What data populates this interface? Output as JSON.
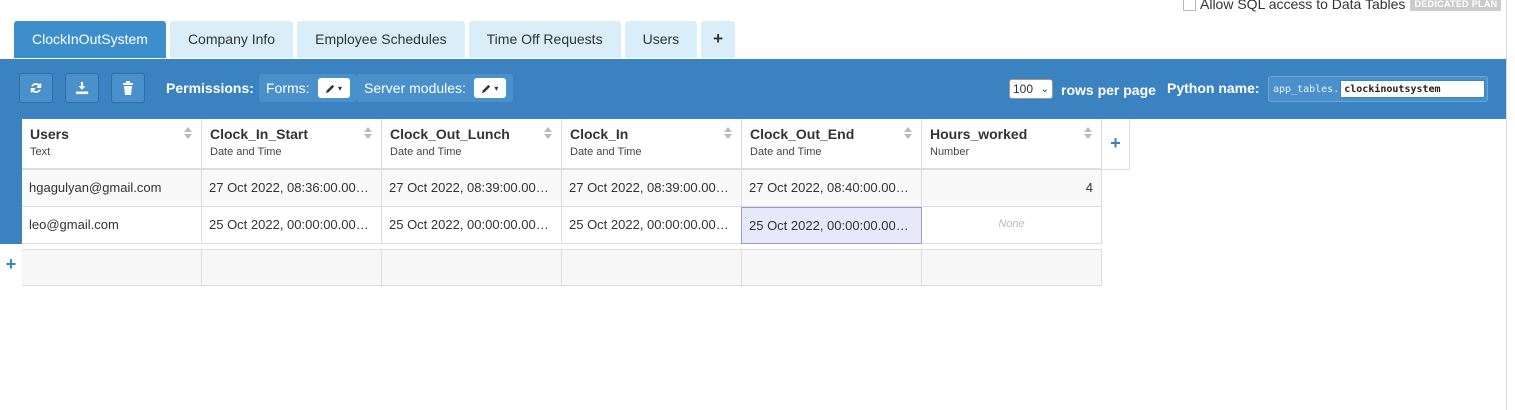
{
  "sql_option": {
    "label": "Allow SQL access to Data Tables",
    "badge": "DEDICATED PLAN"
  },
  "tabs": [
    {
      "label": "ClockInOutSystem",
      "active": true
    },
    {
      "label": "Company Info"
    },
    {
      "label": "Employee Schedules"
    },
    {
      "label": "Time Off Requests"
    },
    {
      "label": "Users"
    }
  ],
  "add_tab_label": "+",
  "toolbar": {
    "permissions_label": "Permissions:",
    "forms_label": "Forms:",
    "server_modules_label": "Server modules:",
    "rows_per_page_value": "100",
    "rows_per_page_label": "rows per page",
    "python_name_label": "Python name:",
    "python_prefix": "app_tables.",
    "python_name_value": "clockinoutsystem"
  },
  "columns": [
    {
      "name": "Users",
      "type": "Text"
    },
    {
      "name": "Clock_In_Start",
      "type": "Date and Time"
    },
    {
      "name": "Clock_Out_Lunch",
      "type": "Date and Time"
    },
    {
      "name": "Clock_In",
      "type": "Date and Time"
    },
    {
      "name": "Clock_Out_End",
      "type": "Date and Time"
    },
    {
      "name": "Hours_worked",
      "type": "Number"
    }
  ],
  "rows": [
    [
      "hgagulyan@gmail.com",
      "27 Oct 2022, 08:36:00.000…",
      "27 Oct 2022, 08:39:00.000…",
      "27 Oct 2022, 08:39:00.000…",
      "27 Oct 2022, 08:40:00.000…",
      "4"
    ],
    [
      "leo@gmail.com",
      "25 Oct 2022, 00:00:00.000…",
      "25 Oct 2022, 00:00:00.000…",
      "25 Oct 2022, 00:00:00.000…",
      "25 Oct 2022, 00:00:00.000…",
      "None"
    ]
  ],
  "colors": {
    "accent": "#3b83c0",
    "tab_inactive": "#d9eef9",
    "tab_active": "#3d8fcb"
  }
}
